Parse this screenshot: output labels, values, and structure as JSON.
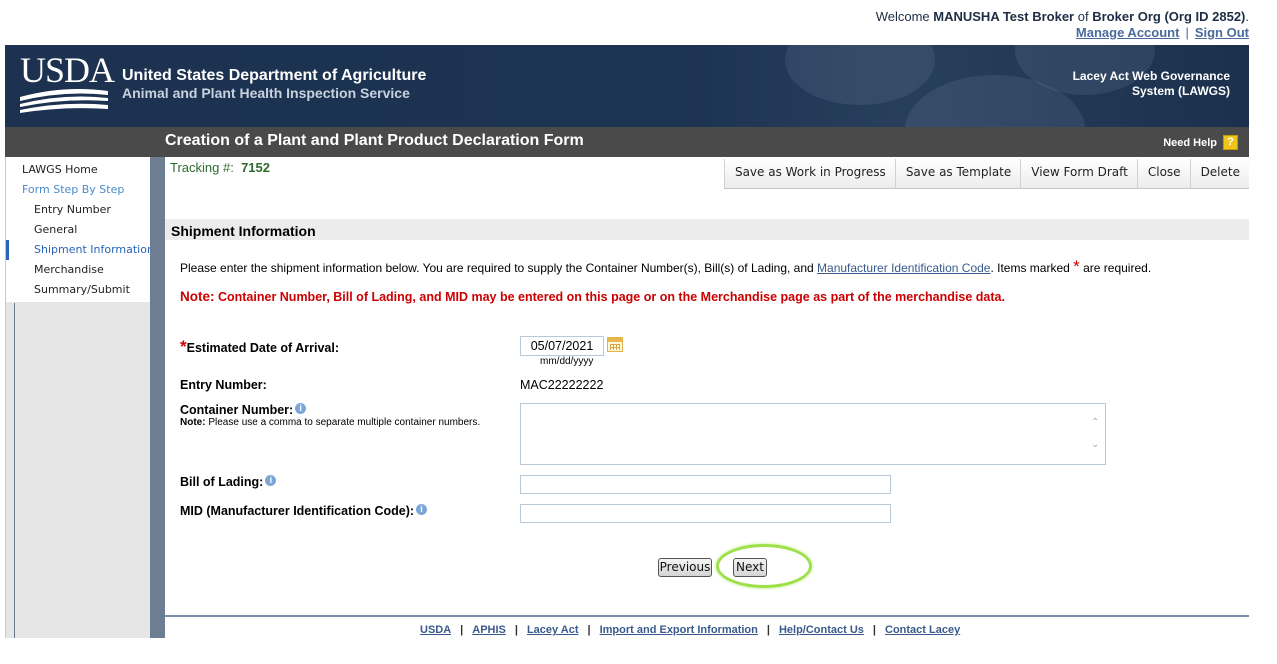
{
  "welcome": {
    "prefix": "Welcome",
    "user": "MANUSHA Test Broker",
    "of": "of",
    "org": "Broker Org (Org ID 2852)",
    "period": ".",
    "manage_account": "Manage Account",
    "sep": "|",
    "sign_out": "Sign Out"
  },
  "banner": {
    "logo_text": "USDA",
    "agency_line1": "United States Department of Agriculture",
    "agency_line2": "Animal and Plant Health Inspection Service",
    "system_line1": "Lacey Act Web Governance",
    "system_line2": "System (LAWGS)"
  },
  "titlebar": {
    "title": "Creation of a Plant and Plant Product Declaration Form",
    "need_help": "Need Help",
    "help_glyph": "?"
  },
  "sidebar": {
    "items": [
      {
        "label": "LAWGS Home"
      },
      {
        "label": "Form Step By Step"
      },
      {
        "label": "Entry Number"
      },
      {
        "label": "General"
      },
      {
        "label": "Shipment Information"
      },
      {
        "label": "Merchandise"
      },
      {
        "label": "Summary/Submit"
      }
    ]
  },
  "tracking": {
    "label": "Tracking #:",
    "value": "7152"
  },
  "toolbar": {
    "save_wip": "Save as Work in Progress",
    "save_template": "Save as Template",
    "view_draft": "View Form Draft",
    "close": "Close",
    "delete": "Delete"
  },
  "section": {
    "title": "Shipment Information"
  },
  "intro": {
    "text1": "Please enter the shipment information below. You are required to supply the Container Number(s), Bill(s) of Lading, and ",
    "link": "Manufacturer Identification Code",
    "text2": ". Items marked ",
    "star": "*",
    "text3": " are required."
  },
  "note": {
    "label": "Note:",
    "text": " Container Number, Bill of Lading, and MID may be entered on this page or on the Merchandise page as part of the merchandise data."
  },
  "form": {
    "star": "*",
    "eda_label": "Estimated Date of Arrival:",
    "eda_value": "05/07/2021",
    "eda_hint": "mm/dd/yyyy",
    "entry_label": "Entry Number:",
    "entry_value": "MAC22222222",
    "container_label": "Container Number:",
    "container_note_label": "Note:",
    "container_note_text": " Please use a comma to separate multiple container numbers.",
    "container_value": "",
    "bol_label": "Bill of Lading:",
    "bol_value": "",
    "mid_label": "MID (Manufacturer Identification Code):",
    "mid_value": "",
    "info_glyph": "i"
  },
  "buttons": {
    "previous": "Previous",
    "next": "Next"
  },
  "footer": {
    "links": [
      "USDA",
      "APHIS",
      "Lacey Act",
      "Import and Export Information",
      "Help/Contact Us",
      "Contact Lacey"
    ],
    "sep": "|"
  },
  "colors": {
    "banner": "#1c3250",
    "title_bar": "#4a4a4a",
    "required_red": "#cc0000",
    "highlight_green": "#9de04a",
    "tracking_green": "#2e6b2e"
  }
}
